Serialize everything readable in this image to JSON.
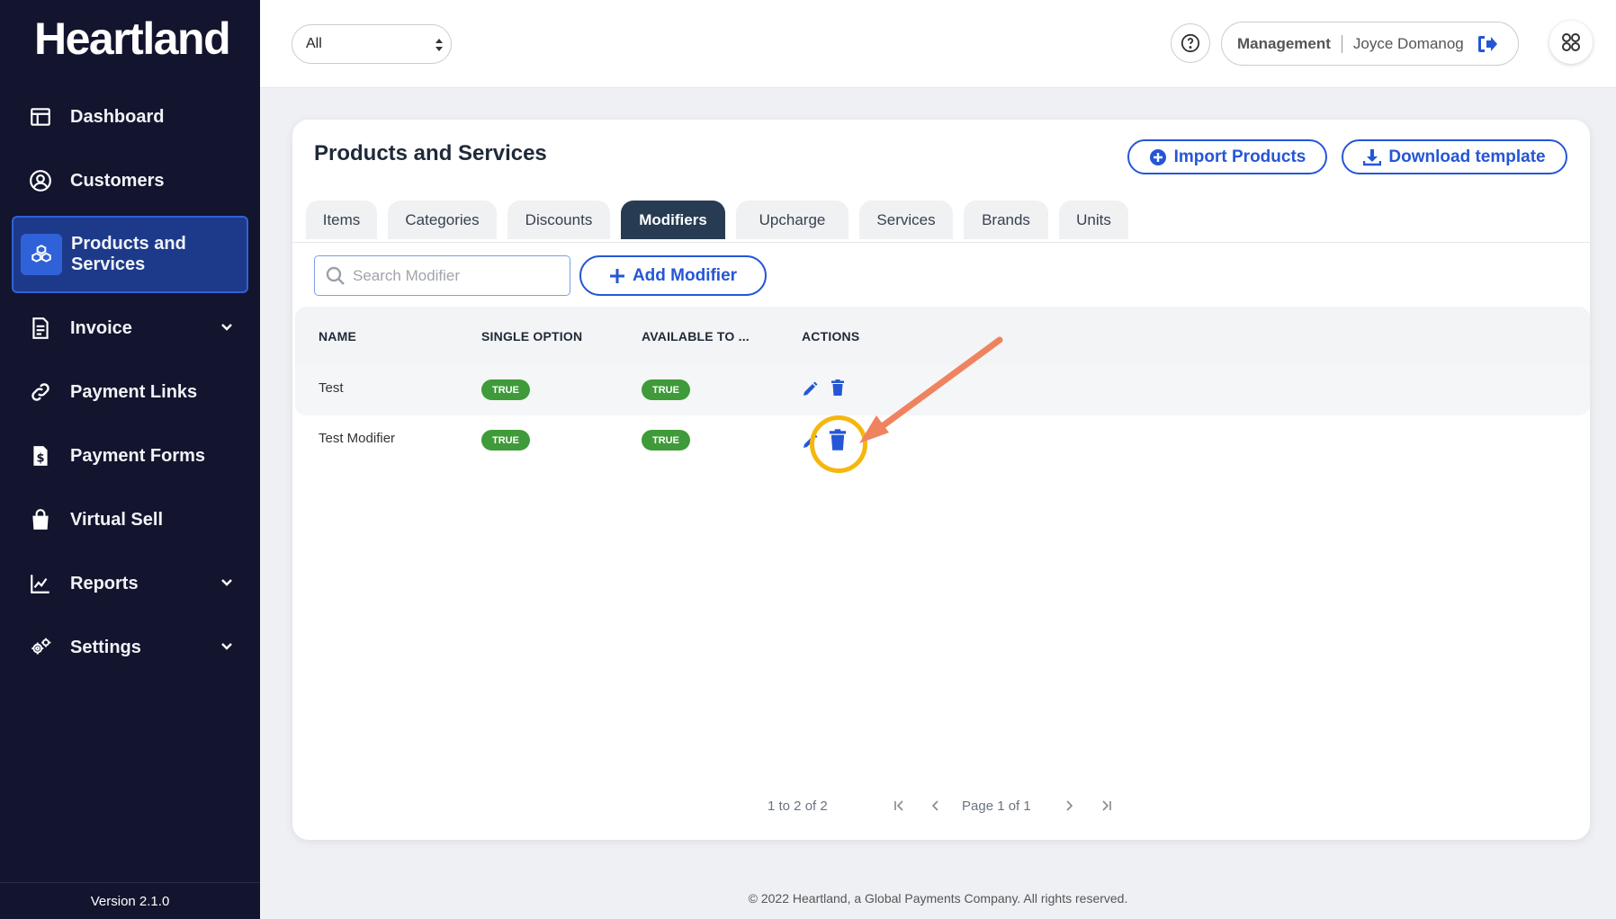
{
  "brand": {
    "name": "Heartland"
  },
  "sidebar": {
    "items": [
      {
        "label": "Dashboard",
        "icon": "dashboard-icon"
      },
      {
        "label": "Customers",
        "icon": "user-circle-icon"
      },
      {
        "label": "Products and Services",
        "icon": "boxes-icon",
        "active": true
      },
      {
        "label": "Invoice",
        "icon": "invoice-icon",
        "has_submenu": true
      },
      {
        "label": "Payment Links",
        "icon": "link-icon"
      },
      {
        "label": "Payment Forms",
        "icon": "dollar-file-icon"
      },
      {
        "label": "Virtual Sell",
        "icon": "shopping-bag-icon"
      },
      {
        "label": "Reports",
        "icon": "chart-icon",
        "has_submenu": true
      },
      {
        "label": "Settings",
        "icon": "gears-icon",
        "has_submenu": true
      }
    ],
    "version": "Version 2.1.0"
  },
  "header": {
    "location_select": "All",
    "role": "Management",
    "user_name": "Joyce Domanog"
  },
  "card": {
    "title": "Products and Services",
    "import_label": "Import Products",
    "download_label": "Download template",
    "tabs": [
      {
        "label": "Items"
      },
      {
        "label": "Categories"
      },
      {
        "label": "Discounts"
      },
      {
        "label": "Modifiers",
        "active": true
      },
      {
        "label": "Upcharge"
      },
      {
        "label": "Services"
      },
      {
        "label": "Brands"
      },
      {
        "label": "Units"
      }
    ],
    "search_placeholder": "Search Modifier",
    "add_label": "Add Modifier",
    "table": {
      "columns": [
        "NAME",
        "SINGLE OPTION",
        "AVAILABLE TO ...",
        "ACTIONS"
      ],
      "rows": [
        {
          "name": "Test",
          "single_option": "TRUE",
          "available_to": "TRUE"
        },
        {
          "name": "Test Modifier",
          "single_option": "TRUE",
          "available_to": "TRUE"
        }
      ]
    },
    "pagination": {
      "range": "1 to 2 of 2",
      "page": "Page 1 of 1"
    }
  },
  "footer": "© 2022 Heartland, a Global Payments Company. All rights reserved.",
  "colors": {
    "sidebar_bg": "#13152e",
    "accent": "#2556d6",
    "active_tab": "#273c53",
    "badge": "#3f9a3a",
    "highlight": "#f5b70e",
    "arrow": "#f0835f"
  }
}
